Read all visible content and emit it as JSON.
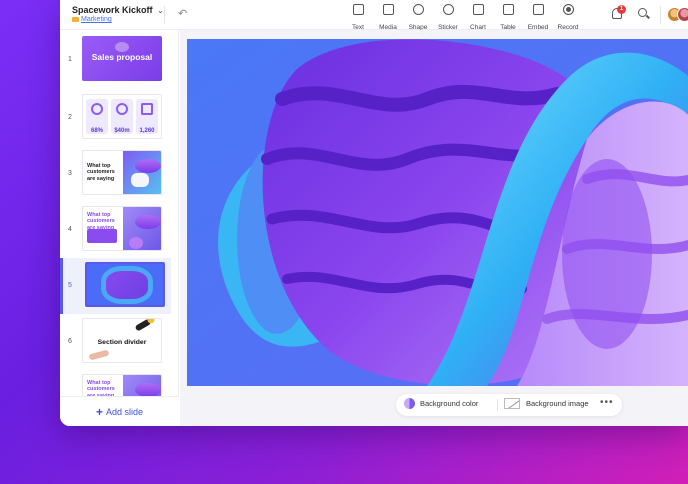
{
  "document": {
    "title": "Spacework Kickoff",
    "folder": "Marketing"
  },
  "toolbar": {
    "tools": [
      {
        "label": "Text",
        "icon": "text-icon"
      },
      {
        "label": "Media",
        "icon": "media-icon"
      },
      {
        "label": "Shape",
        "icon": "shape-icon"
      },
      {
        "label": "Sticker",
        "icon": "sticker-icon"
      },
      {
        "label": "Chart",
        "icon": "chart-icon"
      },
      {
        "label": "Table",
        "icon": "table-icon"
      },
      {
        "label": "Embed",
        "icon": "embed-icon"
      },
      {
        "label": "Record",
        "icon": "record-icon"
      }
    ],
    "notification_count": "1"
  },
  "sidebar": {
    "slides": [
      {
        "number": "1",
        "title": "Sales proposal"
      },
      {
        "number": "2",
        "stats": [
          "68%",
          "$40m",
          "1,260"
        ]
      },
      {
        "number": "3",
        "title": "What top customers are saying"
      },
      {
        "number": "4",
        "title": "What top customers are saying"
      },
      {
        "number": "5"
      },
      {
        "number": "6",
        "title": "Section divider"
      },
      {
        "number": "7",
        "title": "What top customers are saying"
      }
    ],
    "add_slide_label": "Add slide"
  },
  "canvas": {
    "background_color_label": "Background color",
    "background_image_label": "Background image",
    "more_label": "•••"
  },
  "colors": {
    "accent": "#5a5ae8",
    "link": "#3b4fd8",
    "badge": "#e53935"
  }
}
